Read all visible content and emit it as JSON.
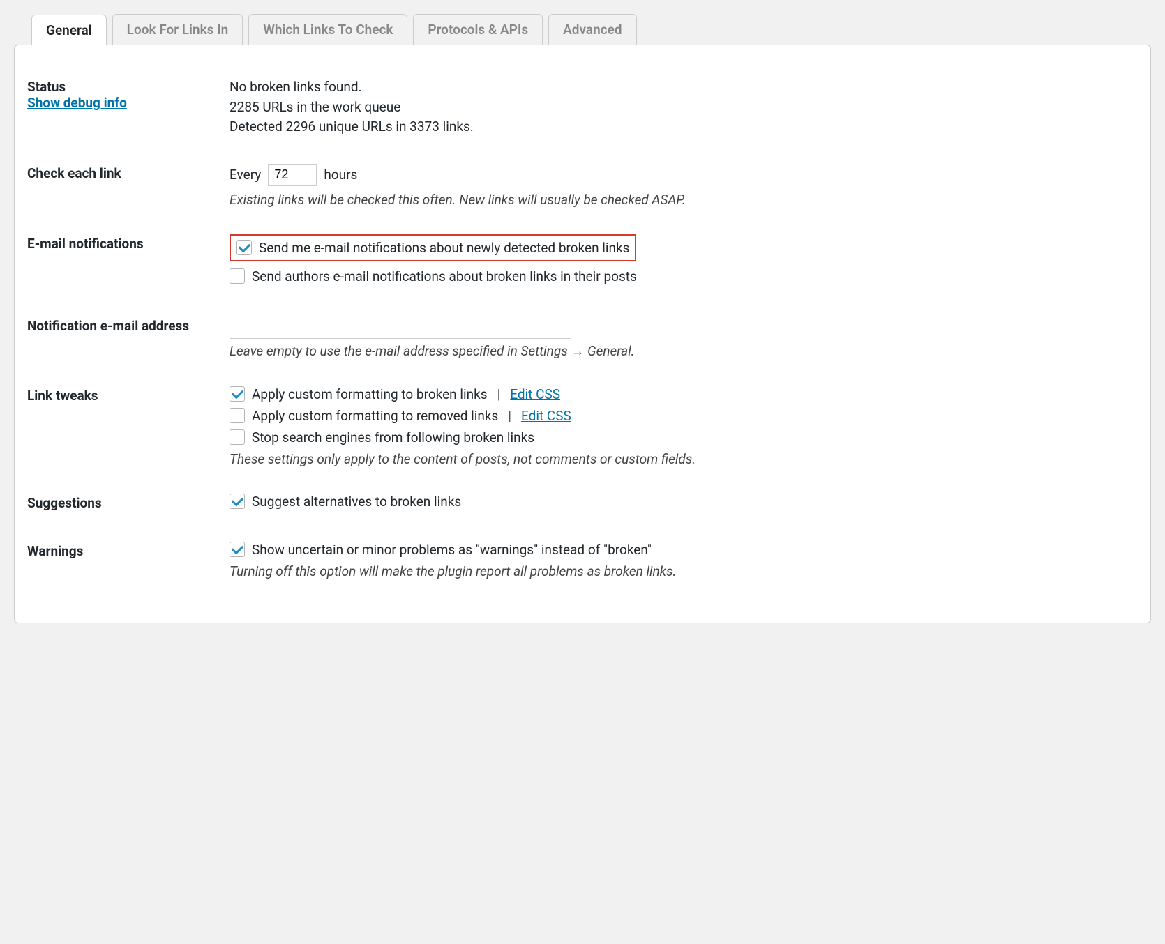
{
  "tabs": {
    "general": "General",
    "look_for": "Look For Links In",
    "which": "Which Links To Check",
    "protocols": "Protocols & APIs",
    "advanced": "Advanced"
  },
  "status": {
    "label": "Status",
    "debug_link": "Show debug info",
    "line1": "No broken links found.",
    "line2": "2285 URLs in the work queue",
    "line3": "Detected 2296 unique URLs in 3373 links."
  },
  "check_each": {
    "label": "Check each link",
    "prefix": "Every",
    "value": "72",
    "suffix": "hours",
    "desc": "Existing links will be checked this often. New links will usually be checked ASAP."
  },
  "email_notif": {
    "label": "E-mail notifications",
    "opt1": "Send me e-mail notifications about newly detected broken links",
    "opt2": "Send authors e-mail notifications about broken links in their posts"
  },
  "notif_email": {
    "label": "Notification e-mail address",
    "value": "",
    "desc": "Leave empty to use the e-mail address specified in Settings → General."
  },
  "link_tweaks": {
    "label": "Link tweaks",
    "opt1": "Apply custom formatting to broken links",
    "opt2": "Apply custom formatting to removed links",
    "opt3": "Stop search engines from following broken links",
    "edit_css": "Edit CSS",
    "desc": "These settings only apply to the content of posts, not comments or custom fields."
  },
  "suggestions": {
    "label": "Suggestions",
    "opt1": "Suggest alternatives to broken links"
  },
  "warnings": {
    "label": "Warnings",
    "opt1": "Show uncertain or minor problems as \"warnings\" instead of \"broken\"",
    "desc": "Turning off this option will make the plugin report all problems as broken links."
  }
}
